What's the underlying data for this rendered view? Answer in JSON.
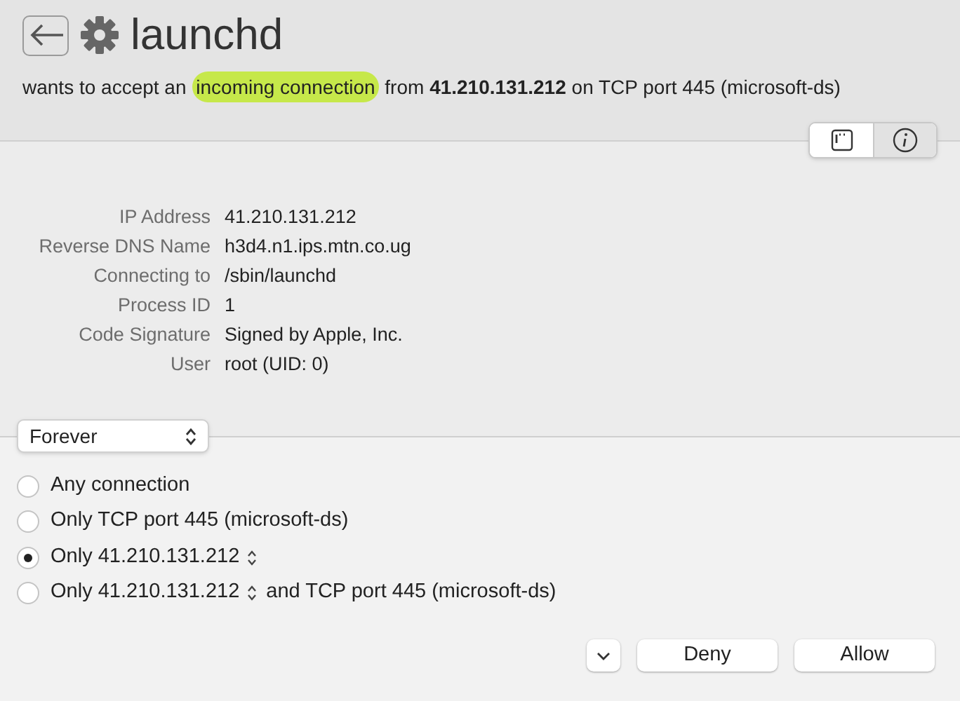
{
  "header": {
    "title": "launchd",
    "message": [
      {
        "kind": "plain",
        "text": "wants to accept an "
      },
      {
        "kind": "highlight",
        "text": "incoming connection"
      },
      {
        "kind": "plain",
        "text": " from **41.210.131.212** on TCP port 445 (microsoft-ds)"
      }
    ],
    "view_toggle": [
      {
        "kind": "list",
        "selected": false
      },
      {
        "kind": "info",
        "selected": true
      }
    ]
  },
  "details": [
    {
      "label": "IP Address",
      "value": "41.210.131.212"
    },
    {
      "label": "Reverse DNS Name",
      "value": "h3d4.n1.ips.mtn.co.ug"
    },
    {
      "label": "Connecting to",
      "value": "/sbin/launchd"
    },
    {
      "label": "Process ID",
      "value": "1"
    },
    {
      "label": "Code Signature",
      "value": "Signed by Apple, Inc."
    },
    {
      "label": "User",
      "value": "root (UID: 0)"
    }
  ],
  "duration": {
    "value": "Forever"
  },
  "scope_options": [
    {
      "kind": "plain",
      "label": "Any connection",
      "selected": false
    },
    {
      "kind": "plain",
      "label": "Only TCP port 445 (microsoft-ds)",
      "selected": false
    },
    {
      "kind": "address",
      "label": "Only 41.210.131.212",
      "selected": true
    },
    {
      "kind": "address",
      "label": "Only 41.210.131.212",
      "suffix": "and TCP port 445 (microsoft-ds)",
      "selected": false
    }
  ],
  "buttons": [
    "Deny",
    "Allow"
  ]
}
